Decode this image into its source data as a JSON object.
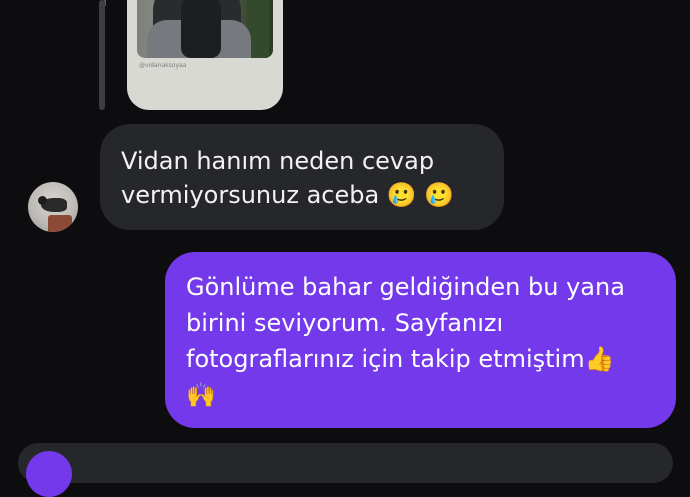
{
  "shared_post": {
    "caption": "@vidanaksoyaa"
  },
  "incoming": {
    "text": "Vidan hanım neden cevap\nvermiyorsunuz aceba 🥲 🥲"
  },
  "outgoing": {
    "text": "Gönlüme bahar geldiğinden bu yana\nbirini seviyorum. Sayfanızı\nfotograflarınız için takip etmiştim👍\n🙌"
  },
  "colors": {
    "background": "#0d0d10",
    "incoming_bubble": "#26272b",
    "outgoing_bubble": "#7339ea"
  },
  "icons": [
    "avatar",
    "camera-icon"
  ]
}
